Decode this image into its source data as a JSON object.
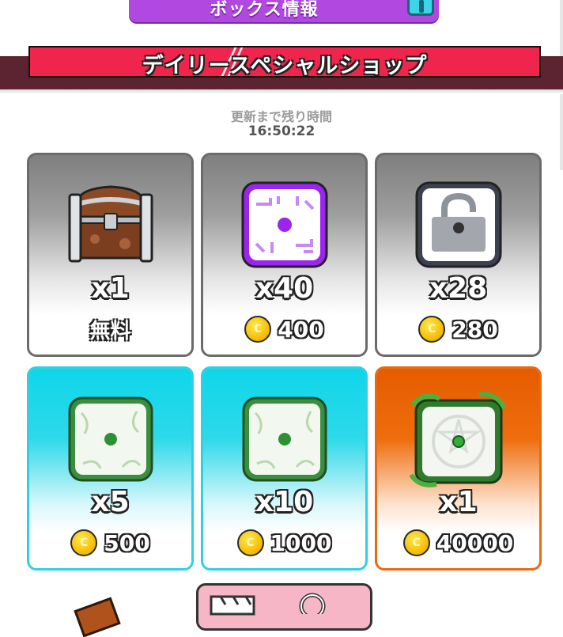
{
  "header": {
    "box_info_label": "ボックス情報",
    "info_icon": "info-icon"
  },
  "banner": {
    "title": "デイリースペシャルショップ"
  },
  "timer": {
    "label": "更新まで残り時間",
    "value": "16:50:22"
  },
  "currency_glyph": "C",
  "cards": [
    {
      "item": "treasure-chest-icon",
      "qty": "x1",
      "free_label": "無料",
      "color": "#9e9e9e"
    },
    {
      "item": "purple-dice-icon",
      "qty": "x40",
      "price": "400",
      "color": "#9e9e9e"
    },
    {
      "item": "unlock-icon",
      "qty": "x28",
      "price": "280",
      "color": "#9e9e9e"
    },
    {
      "item": "green-dice-icon",
      "qty": "x5",
      "price": "500",
      "color": "#0fd6ea"
    },
    {
      "item": "green-dice-icon",
      "qty": "x10",
      "price": "1000",
      "color": "#0fd6ea"
    },
    {
      "item": "vine-dice-icon",
      "qty": "x1",
      "price": "40000",
      "color": "#e65c00"
    }
  ]
}
